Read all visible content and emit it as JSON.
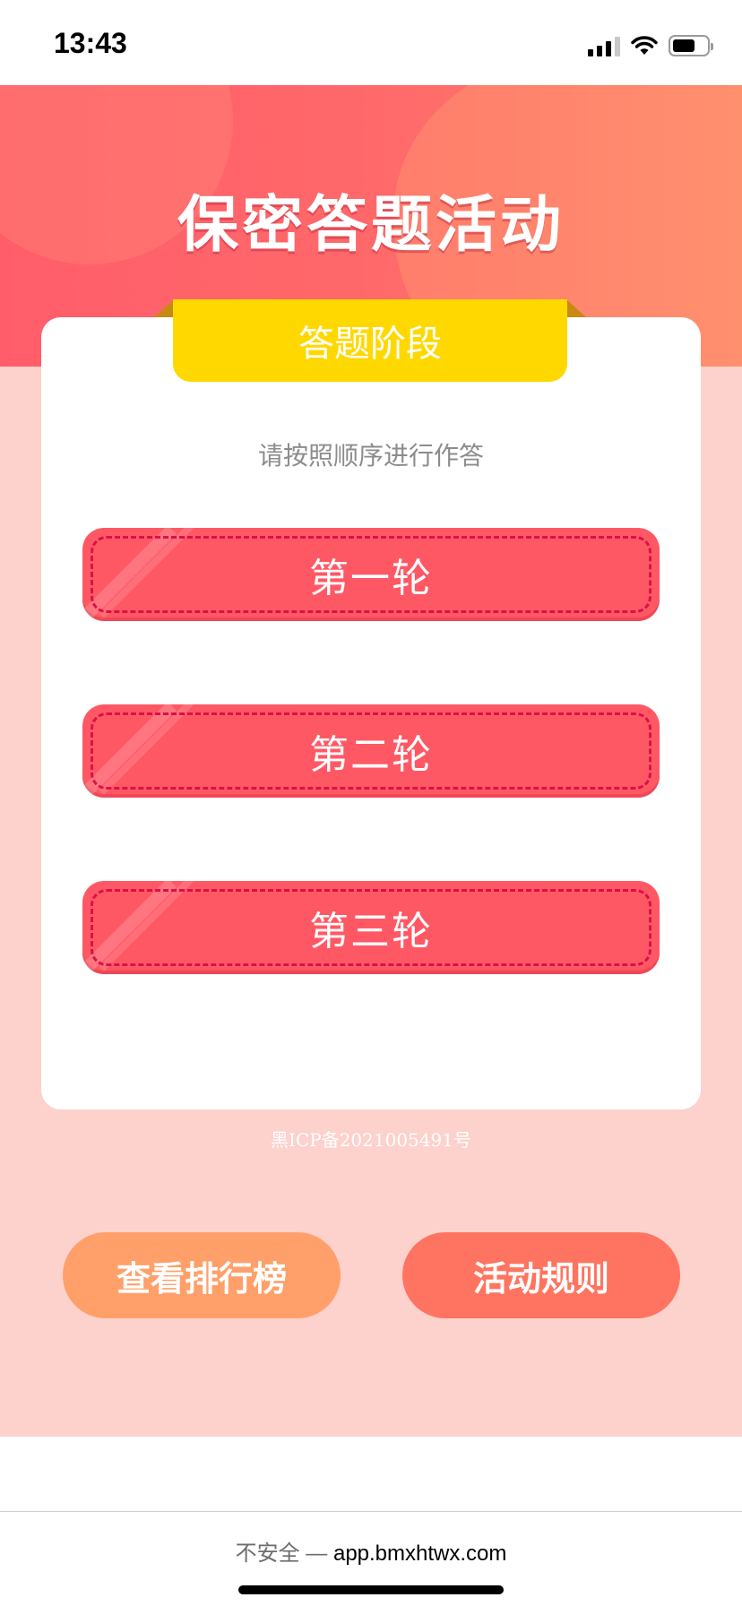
{
  "status_bar": {
    "time": "13:43",
    "icons": [
      "cellular-signal-icon",
      "wifi-icon",
      "battery-icon"
    ]
  },
  "page": {
    "title": "保密答题活动",
    "stage_ribbon": "答题阶段",
    "instruction": "请按照顺序进行作答",
    "rounds": [
      {
        "label": "第一轮"
      },
      {
        "label": "第二轮"
      },
      {
        "label": "第三轮"
      }
    ],
    "icp": "黑ICP备2021005491号",
    "buttons": {
      "leaderboard": "查看排行榜",
      "rules": "活动规则"
    }
  },
  "browser": {
    "insecure_label": "不安全 —",
    "url": "app.bmxhtwx.com"
  },
  "colors": {
    "hero_red": "#ff5d6a",
    "ribbon_yellow": "#ffd800",
    "round_button": "#ff5865",
    "dash_border": "#d9124a",
    "background_pink": "#fdd1cc",
    "leaderboard_button": "#ffa06a",
    "rules_button": "#ff7460"
  }
}
